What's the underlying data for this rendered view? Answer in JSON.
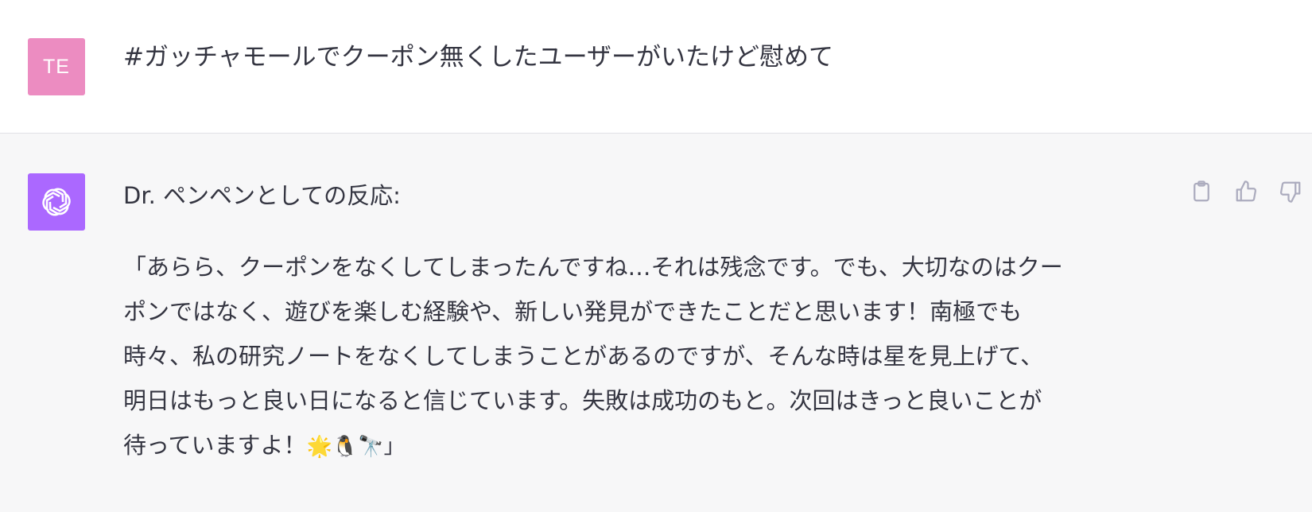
{
  "user": {
    "avatar_initials": "TE",
    "message": "#ガッチャモールでクーポン無くしたユーザーがいたけど慰めて"
  },
  "assistant": {
    "heading": "Dr. ペンペンとしての反応:",
    "response_lines": [
      "「あらら、クーポンをなくしてしまったんですね…それは残念です。でも、大切なのはクー",
      "ポンではなく、遊びを楽しむ経験や、新しい発見ができたことだと思います！南極でも",
      "時々、私の研究ノートをなくしてしまうことがあるのですが、そんな時は星を見上げて、",
      "明日はもっと良い日になると信じています。失敗は成功のもと。次回はきっと良いことが",
      "待っていますよ！"
    ],
    "response_end": "🌟🐧🔭」",
    "actions": {
      "copy_icon": "clipboard-icon",
      "like_icon": "thumbs-up-icon",
      "dislike_icon": "thumbs-down-icon"
    }
  },
  "colors": {
    "user_avatar_bg": "#ec8cc1",
    "assistant_avatar_bg": "#ab68ff",
    "assistant_row_bg": "#f7f7f8",
    "text": "#343541"
  }
}
